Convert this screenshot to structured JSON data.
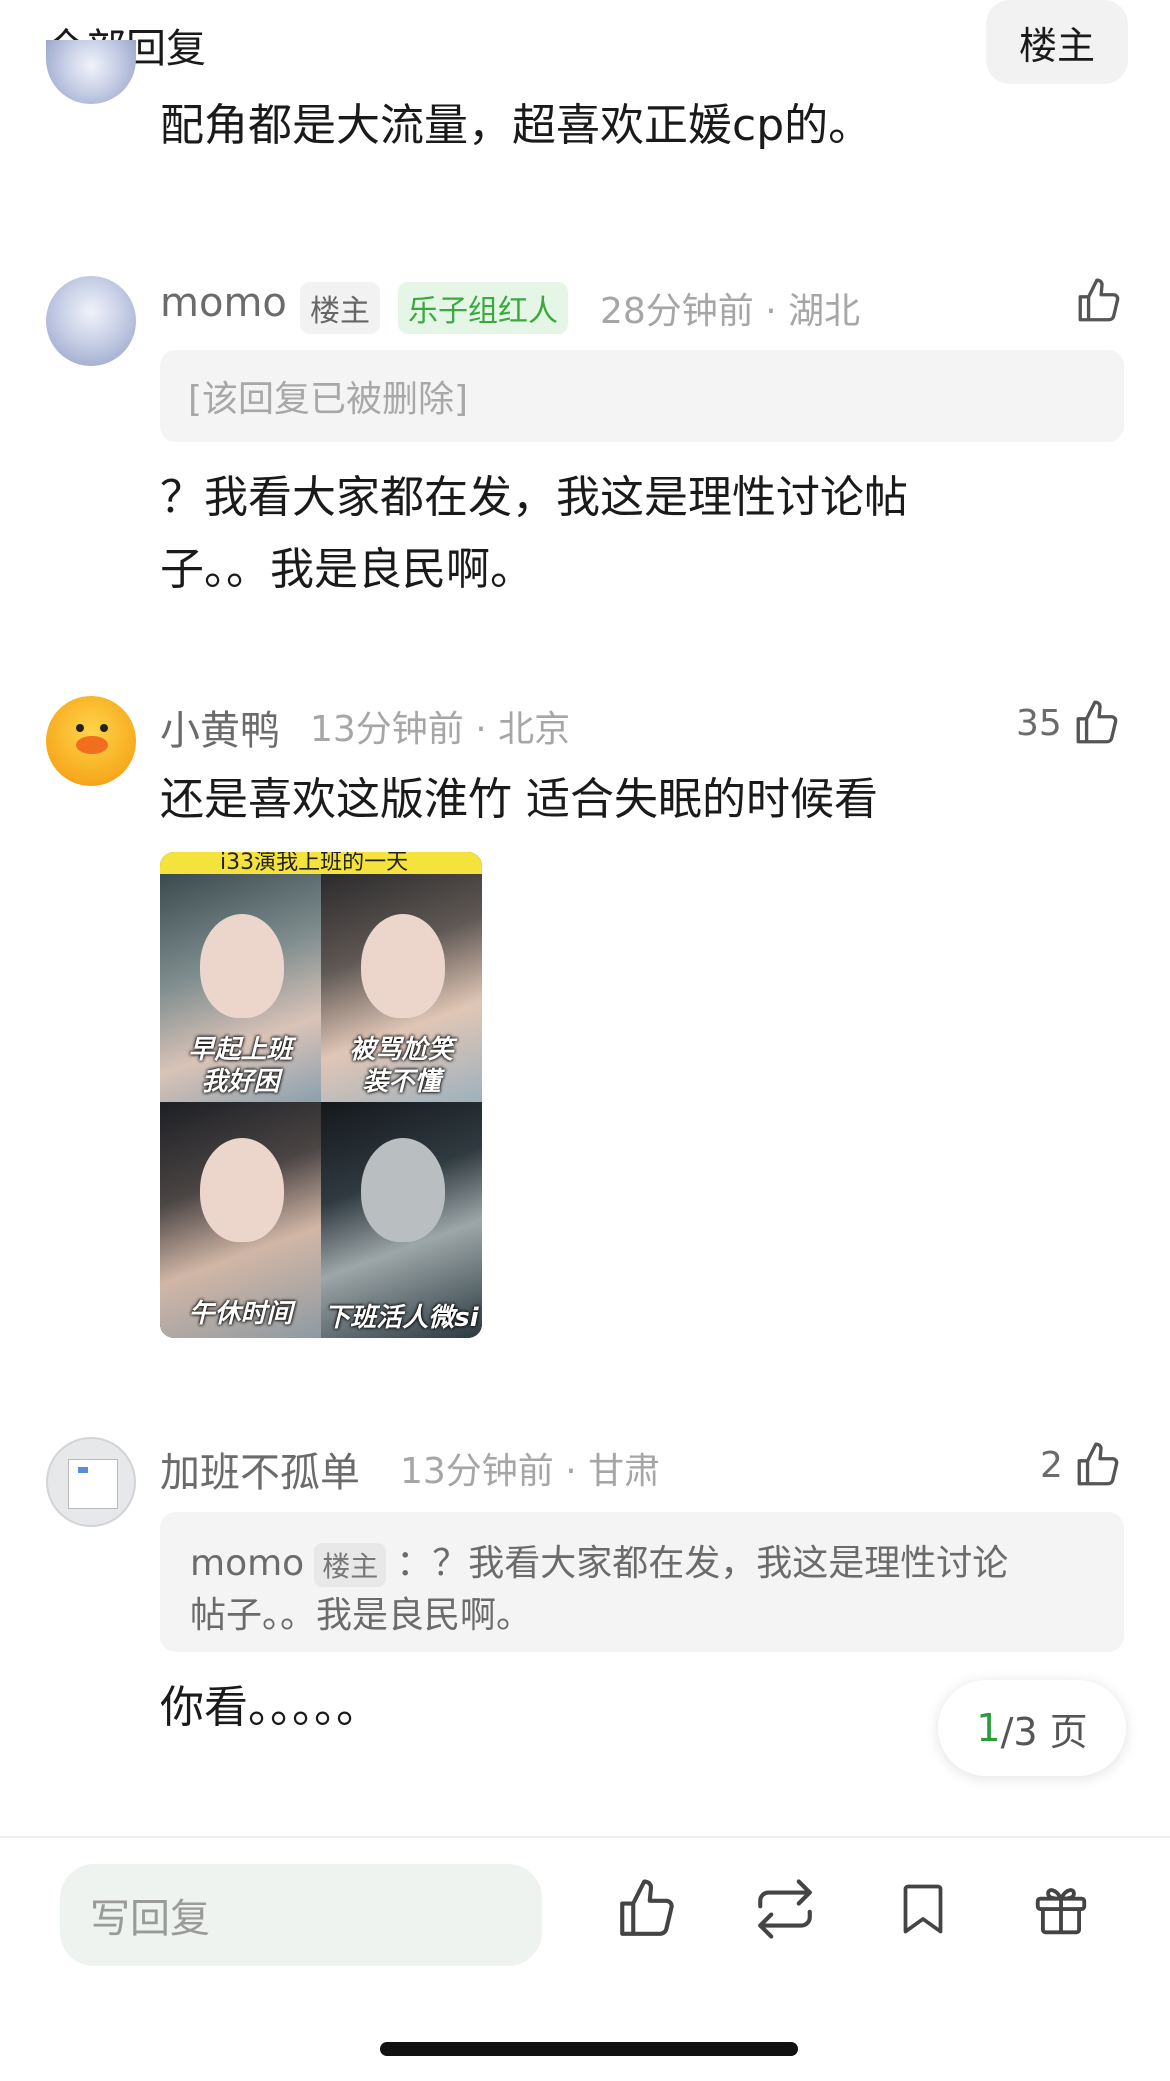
{
  "header": {
    "title": "全部回复",
    "op_button": "楼主"
  },
  "comments": [
    {
      "text": "配角都是大流量，超喜欢正媛cp的。"
    },
    {
      "username": "momo",
      "op_tag": "楼主",
      "fan_tag": "乐子组红人",
      "meta": "28分钟前 · 湖北",
      "deleted_quote": "[该回复已被删除]",
      "text_lines": [
        "？我看大家都在发，我这是理性讨论帖",
        "子。。我是良民啊。"
      ]
    },
    {
      "username": "小黄鸭",
      "meta": "13分钟前 · 北京",
      "likes": "35",
      "text": "还是喜欢这版淮竹 适合失眠的时候看",
      "image": {
        "banner": "i33演我上班的一天",
        "captions": [
          [
            "早起上班",
            "我好困"
          ],
          [
            "被骂尬笑",
            "装不懂"
          ],
          [
            "午休时间"
          ],
          [
            "下班活人微si"
          ]
        ]
      }
    },
    {
      "username": "加班不孤单",
      "meta": "13分钟前 · 甘肃",
      "likes": "2",
      "quote": {
        "user": "momo",
        "op_tag": "楼主",
        "line1": "：？我看大家都在发，我这是理性讨论",
        "line2": "帖子。。我是良民啊。"
      },
      "text": "你看。。。。。"
    }
  ],
  "pagination": {
    "current": "1",
    "total_suffix": "/3 页"
  },
  "bottom_bar": {
    "reply_placeholder": "写回复",
    "icons": [
      "thumbs-up-icon",
      "repost-icon",
      "bookmark-icon",
      "gift-icon"
    ]
  },
  "colors": {
    "green_accent": "#2e9c3d",
    "fan_tag_bg": "#e5f6e6",
    "meta_gray": "#a6a6a6"
  }
}
